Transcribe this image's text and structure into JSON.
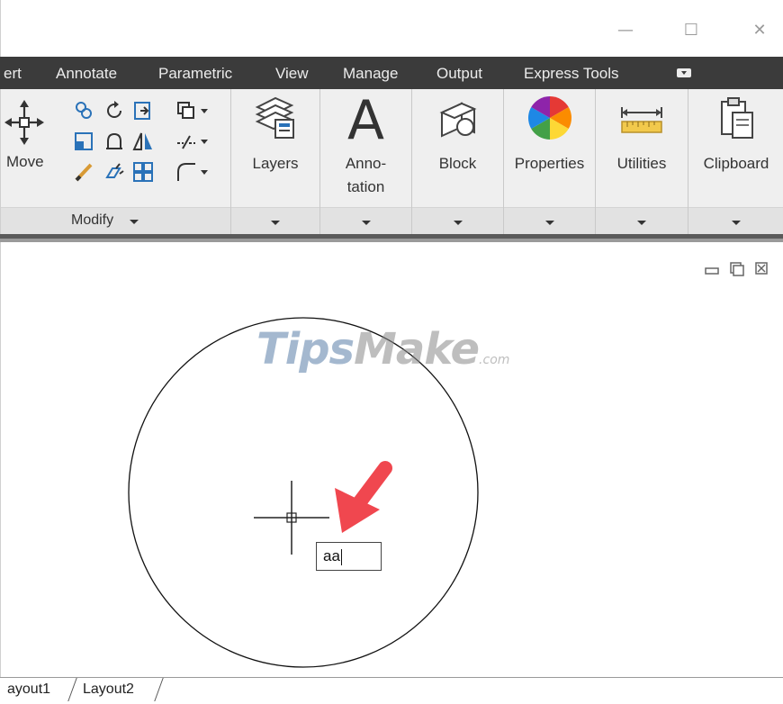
{
  "window": {
    "buttons": {
      "minimize": "—",
      "maximize": "☐",
      "close": "✕"
    }
  },
  "tabs": [
    "ert",
    "Annotate",
    "Parametric",
    "View",
    "Manage",
    "Output",
    "Express Tools"
  ],
  "ribbon": {
    "modify": {
      "move_label": "Move",
      "footer_label": "Modify"
    },
    "panels": {
      "layers": "Layers",
      "annotation_line1": "Anno-",
      "annotation_line2": "tation",
      "annotation_glyph": "A",
      "block": "Block",
      "properties": "Properties",
      "utilities": "Utilities",
      "clipboard": "Clipboard"
    }
  },
  "canvas": {
    "watermark": {
      "part1": "Tips",
      "part2": "Make",
      "suffix": ".com"
    },
    "text_input_value": "aa"
  },
  "layout_tabs": [
    "ayout1",
    "Layout2"
  ],
  "icons": {
    "window": [
      "minimize-icon",
      "maximize-icon",
      "close-icon"
    ],
    "modify_tools": [
      "move-icon",
      "copy-icon",
      "rotate-icon",
      "trim-icon",
      "array-icon",
      "scale-icon",
      "stretch-icon",
      "mirror-icon",
      "break-icon",
      "erase-icon",
      "explode-icon",
      "offset-icon",
      "fillet-icon",
      "rectangular-array-icon"
    ],
    "panels": [
      "layers-icon",
      "annotation-icon",
      "block-icon",
      "properties-color-wheel-icon",
      "measure-ruler-icon",
      "clipboard-icon"
    ],
    "canvas": [
      "crosshair-cursor-icon",
      "red-arrow-icon"
    ],
    "viewport": [
      "viewport-minimize-icon",
      "viewport-restore-icon",
      "viewport-close-icon"
    ]
  },
  "colors": {
    "tabbar": "#3b3b3b",
    "ribbon": "#efefef",
    "arrow": "#f0474f",
    "canvas": "#ffffff"
  }
}
